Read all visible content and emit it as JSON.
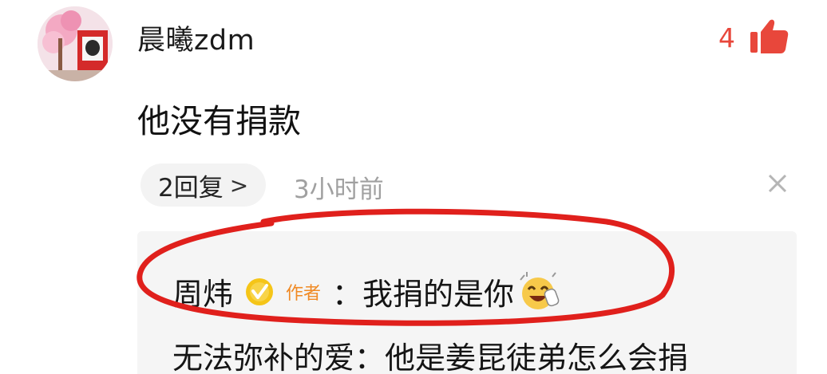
{
  "comment": {
    "username": "晨曦zdm",
    "like_count": "4",
    "text": "他没有捐款",
    "reply_count_label": "2回复",
    "reply_chevron": ">",
    "timestamp": "3小时前"
  },
  "replies": [
    {
      "name": "周炜",
      "badge": "作者",
      "separator": "：",
      "text": "我捐的是你"
    },
    {
      "name": "无法弥补的爱",
      "separator": "：",
      "text": "他是姜昆徒弟怎么会捐"
    }
  ],
  "icons": {
    "like": "thumbs-up-icon",
    "close": "close-icon",
    "verified": "verified-badge-icon",
    "emoji": "laughing-emoji-icon"
  },
  "colors": {
    "like": "#e8473b",
    "author_tag": "#f08a24",
    "verified": "#f5c518",
    "annotation": "#e0201c"
  }
}
